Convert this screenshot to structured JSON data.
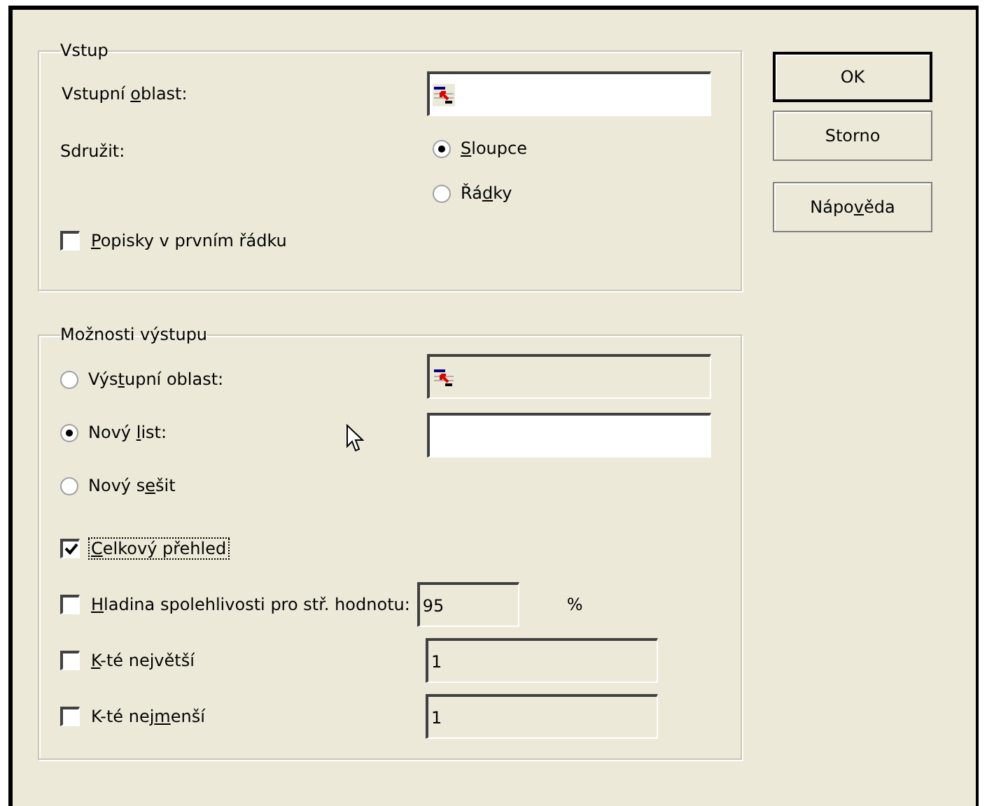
{
  "input_group": {
    "title": "Vstup",
    "range": {
      "label": {
        "pre": "Vstupní ",
        "key": "o",
        "post": "blast:"
      }
    },
    "group_by": {
      "label": "Sdružit:",
      "options": [
        {
          "label": {
            "key": "S",
            "post": "loupce"
          },
          "selected": true
        },
        {
          "label": {
            "pre": "Řá",
            "key": "d",
            "post": "ky"
          },
          "selected": false
        }
      ]
    },
    "labels_in_first_row": {
      "label": {
        "key": "P",
        "post": "opisky v prvním řádku"
      },
      "checked": false
    }
  },
  "output_group": {
    "title": "Možnosti výstupu",
    "destinations": [
      {
        "label": {
          "pre": "Výs",
          "key": "t",
          "post": "upní oblast:"
        },
        "selected": false,
        "field": {
          "kind": "range",
          "disabled": true
        }
      },
      {
        "label": {
          "pre": "Nový ",
          "key": "l",
          "post": "ist:"
        },
        "selected": true,
        "field": {
          "kind": "text",
          "disabled": false
        }
      },
      {
        "label": {
          "pre": "Nový s",
          "key": "e",
          "post": "šit"
        },
        "selected": false
      }
    ],
    "options": [
      {
        "label": {
          "key": "C",
          "post": "elkový přehled"
        },
        "checked": true,
        "focused": true
      },
      {
        "label": {
          "key": "H",
          "post": "ladina spolehlivosti pro stř. hodnotu:"
        },
        "checked": false,
        "focused": false,
        "field": {
          "value": "95",
          "disabled": true
        },
        "suffix": "%"
      },
      {
        "label": {
          "key": "K",
          "post": "-té největší"
        },
        "checked": false,
        "focused": false,
        "field": {
          "value": "1",
          "disabled": true
        }
      },
      {
        "label": {
          "pre": "K-té nej",
          "key": "m",
          "post": "enší"
        },
        "checked": false,
        "focused": false,
        "field": {
          "value": "1",
          "disabled": true
        }
      }
    ]
  },
  "buttons": [
    {
      "label": {
        "pre": "OK"
      },
      "default": true
    },
    {
      "label": {
        "pre": "Storno"
      },
      "default": false
    },
    {
      "label": {
        "pre": "Nápo",
        "key": "v",
        "post": "ěda"
      },
      "default": false
    }
  ]
}
